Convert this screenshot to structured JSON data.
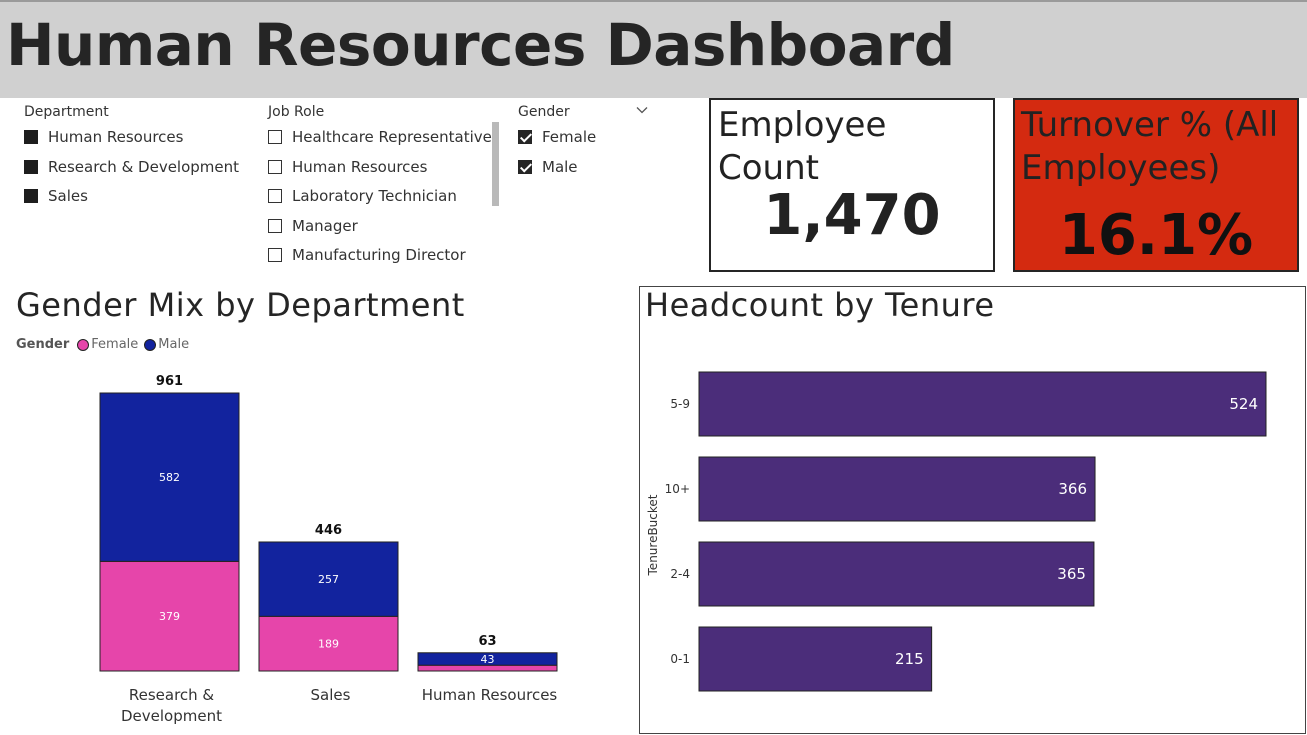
{
  "dashboard_title": "Human Resources Dashboard",
  "slicers": {
    "department": {
      "title": "Department",
      "items": [
        {
          "label": "Human Resources",
          "selected": true
        },
        {
          "label": "Research & Development",
          "selected": true
        },
        {
          "label": "Sales",
          "selected": true
        }
      ]
    },
    "job_role": {
      "title": "Job Role",
      "items": [
        {
          "label": "Healthcare Representative",
          "selected": false
        },
        {
          "label": "Human Resources",
          "selected": false
        },
        {
          "label": "Laboratory Technician",
          "selected": false
        },
        {
          "label": "Manager",
          "selected": false
        },
        {
          "label": "Manufacturing Director",
          "selected": false
        }
      ]
    },
    "gender": {
      "title": "Gender",
      "items": [
        {
          "label": "Female",
          "selected": true
        },
        {
          "label": "Male",
          "selected": true
        }
      ]
    }
  },
  "cards": {
    "employee_count": {
      "label": "Employee Count",
      "value": "1,470"
    },
    "turnover": {
      "label": "Turnover % (All Employees)",
      "label_line1": "Turnover % (All",
      "label_line2": "Employees)",
      "value": "16.1%",
      "color": "#d42a10"
    }
  },
  "chart_data": [
    {
      "type": "bar",
      "stacked": true,
      "title": "Gender Mix by Department",
      "legend_title": "Gender",
      "legend_position": "top-left",
      "categories": [
        "Research & Development",
        "Sales",
        "Human Resources"
      ],
      "category_lines": [
        [
          "Research &",
          "Development"
        ],
        [
          "Sales"
        ],
        [
          "Human Resources"
        ]
      ],
      "series": [
        {
          "name": "Female",
          "values": [
            379,
            189,
            20
          ],
          "color": "#e645aa"
        },
        {
          "name": "Male",
          "values": [
            582,
            257,
            43
          ],
          "color": "#12239e"
        }
      ],
      "totals": [
        961,
        446,
        63
      ],
      "grid": false
    },
    {
      "type": "bar",
      "orientation": "horizontal",
      "title": "Headcount by Tenure",
      "ylabel": "TenureBucket",
      "categories": [
        "5-9",
        "10+",
        "2-4",
        "0-1"
      ],
      "values": [
        524,
        366,
        365,
        215
      ],
      "color": "#4b2d7a",
      "grid": false
    }
  ]
}
